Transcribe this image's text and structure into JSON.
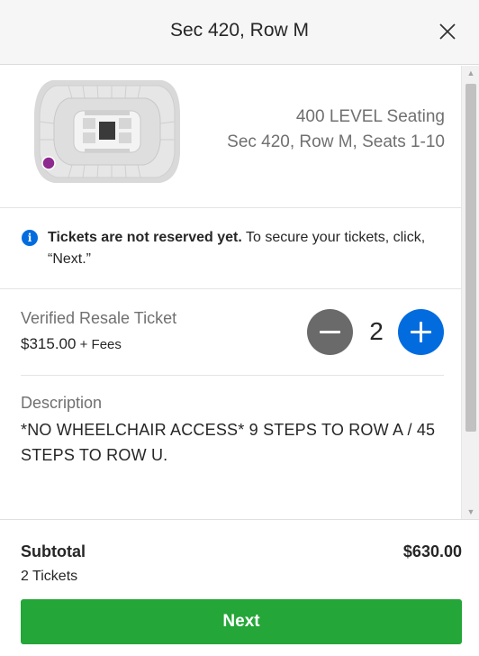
{
  "header": {
    "title": "Sec 420, Row M",
    "close_icon": "close-icon"
  },
  "listing": {
    "level": "400 LEVEL Seating",
    "seats": "Sec 420, Row M, Seats 1-10",
    "map_stage_label": "stage"
  },
  "notice": {
    "icon": "info-icon",
    "bold": "Tickets are not reserved yet.",
    "text": " To secure your tickets, click, “Next.”"
  },
  "ticket": {
    "type": "Verified Resale Ticket",
    "price": "$315.00",
    "fees": " + Fees",
    "quantity": "2"
  },
  "description": {
    "label": "Description",
    "text": "*NO WHEELCHAIR ACCESS* 9 STEPS TO ROW A / 45 STEPS TO ROW U."
  },
  "footer": {
    "subtotal_label": "Subtotal",
    "ticket_count": "2 Tickets",
    "subtotal_amount": "$630.00",
    "next_label": "Next"
  },
  "colors": {
    "primary_blue": "#026cdf",
    "next_green": "#24a638",
    "selected_section": "#8e2a8f",
    "minus_gray": "#6a6a6a"
  }
}
